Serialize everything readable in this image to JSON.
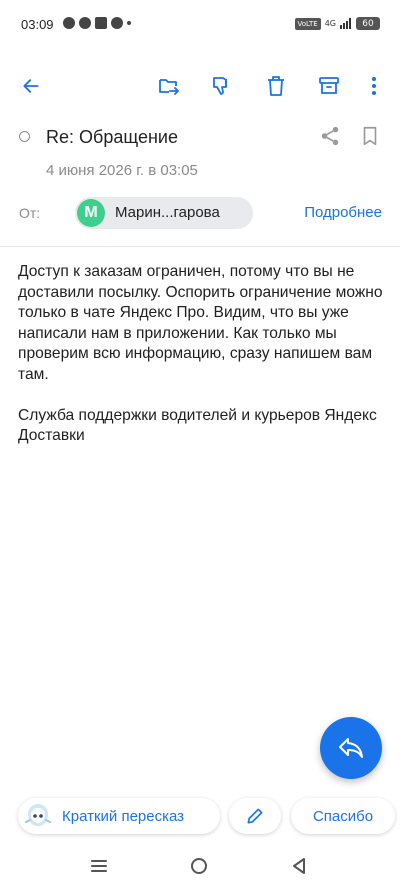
{
  "status_bar": {
    "time": "03:09",
    "volte": "VoLTE",
    "network": "4G",
    "battery": "60"
  },
  "toolbar": {
    "back": "arrow-left-icon",
    "move": "move-to-folder-icon",
    "dislike": "thumb-down-icon",
    "delete": "trash-icon",
    "archive": "archive-icon",
    "more": "more-vert-icon"
  },
  "message": {
    "subject": "Re: Обращение",
    "date": "4 июня 2026 г. в 03:05",
    "from_label": "От:",
    "sender_initial": "М",
    "sender_name": "Марин...гарова",
    "details_link": "Подробнее",
    "body": [
      "Доступ к заказам ограничен, потому что вы не доставили посылку. Оспорить ограничение можно только в чате Яндекс Про. Видим, что вы уже написали нам в приложении. Как только мы проверим всю информацию, сразу напишем вам там.",
      "Служба поддержки водителей и курьеров Яндекс Доставки"
    ]
  },
  "actions": {
    "summary": "Краткий пересказ",
    "thanks": "Спасибо"
  },
  "colors": {
    "accent": "#1a73e8",
    "avatar": "#3ecf8e"
  }
}
